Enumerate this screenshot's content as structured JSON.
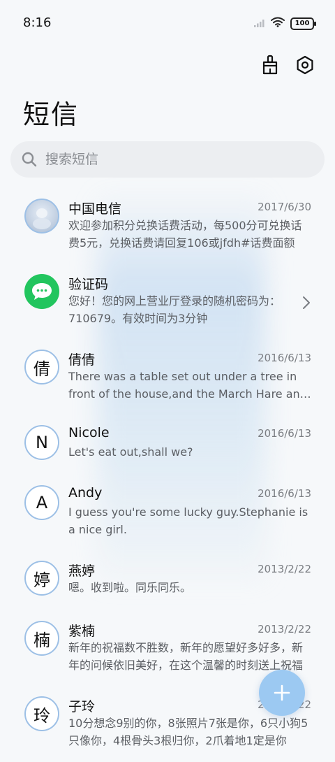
{
  "status": {
    "time": "8:16",
    "battery": "100"
  },
  "title": "短信",
  "search": {
    "placeholder": "搜索短信"
  },
  "conversations": [
    {
      "avatar": "",
      "name": "中国电信",
      "date": "2017/6/30",
      "preview": "欢迎参加积分兑换话费活动，每500分可兑换话费5元，兑换话费请回复106或jfdh#话费面额"
    },
    {
      "avatar": "",
      "name": "验证码",
      "date": "",
      "preview": "您好！您的网上营业厅登录的随机密码为：710679。有效时间为3分钟"
    },
    {
      "avatar": "倩",
      "name": "倩倩",
      "date": "2016/6/13",
      "preview": "There was a table set out under a tree in front of the house,and the March Hare and the Hatter"
    },
    {
      "avatar": "N",
      "name": "Nicole",
      "date": "2016/6/13",
      "preview": "Let's eat out,shall we?"
    },
    {
      "avatar": "A",
      "name": "Andy",
      "date": "2016/6/13",
      "preview": "I guess you're some lucky guy.Stephanie is a nice girl."
    },
    {
      "avatar": "婷",
      "name": "燕婷",
      "date": "2013/2/22",
      "preview": "嗯。收到啦。同乐同乐。"
    },
    {
      "avatar": "楠",
      "name": "紫楠",
      "date": "2013/2/22",
      "preview": "新年的祝福数不胜数，新年的愿望好多好多，新年的问候依旧美好，在这个温馨的时刻送上祝福"
    },
    {
      "avatar": "玲",
      "name": "子玲",
      "date": "2013/2/22",
      "preview": "10分想念9别的你，8张照片7张是你，6只小狗5只像你，4根骨头3根归你，2爪着地1定是你"
    }
  ],
  "icons": {
    "clean": "broom-icon",
    "settings": "settings-icon",
    "search": "search-icon",
    "compose": "plus-icon"
  },
  "colors": {
    "accent": "#9cc9f2",
    "avatar_ring": "#9dc0e6",
    "sms_green": "#22c55e"
  }
}
